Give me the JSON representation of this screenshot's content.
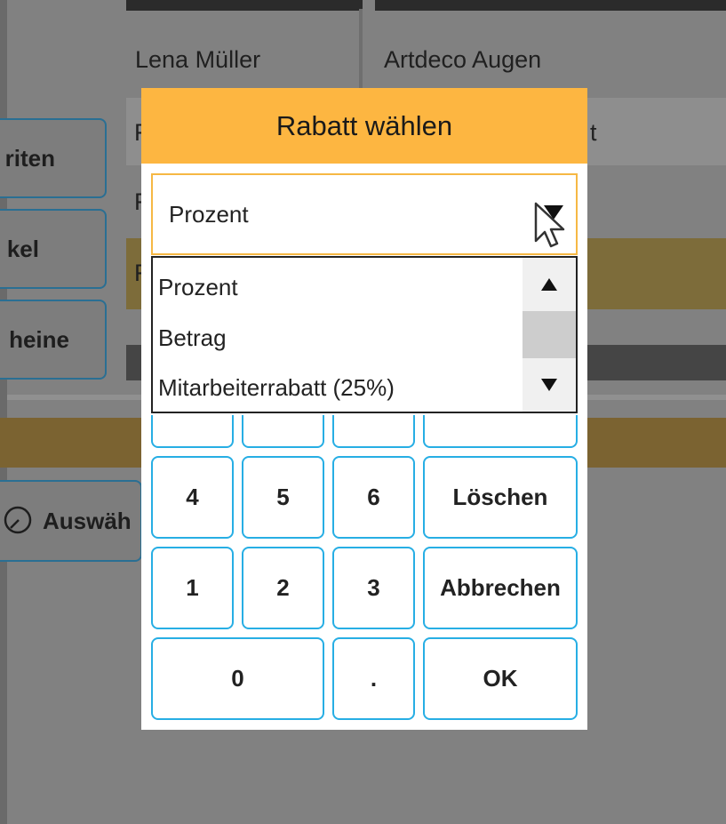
{
  "background": {
    "header_left_name": "Lena Müller",
    "header_right_product": "Artdeco Augen",
    "row1_left_fragment": "F",
    "row1_right_fragment": "t",
    "row2_left_fragment": "F",
    "row3_left_fragment": "F",
    "side_buttons": [
      {
        "label": "riten"
      },
      {
        "label": "kel"
      },
      {
        "label": "heine"
      }
    ],
    "select_button_label": "Auswäh"
  },
  "modal": {
    "title": "Rabatt wählen",
    "select": {
      "value": "Prozent",
      "options": [
        "Prozent",
        "Betrag",
        "Mitarbeiterrabatt (25%)"
      ]
    },
    "keypad": {
      "row_partial": [
        "",
        "",
        "",
        ""
      ],
      "row_456": [
        "4",
        "5",
        "6",
        "Löschen"
      ],
      "row_123": [
        "1",
        "2",
        "3",
        "Abbrechen"
      ],
      "row_bottom": [
        "0",
        ".",
        "OK"
      ]
    }
  },
  "colors": {
    "header_bg": "#fdb641",
    "key_border": "#27aee4",
    "overlay": "#818181"
  }
}
